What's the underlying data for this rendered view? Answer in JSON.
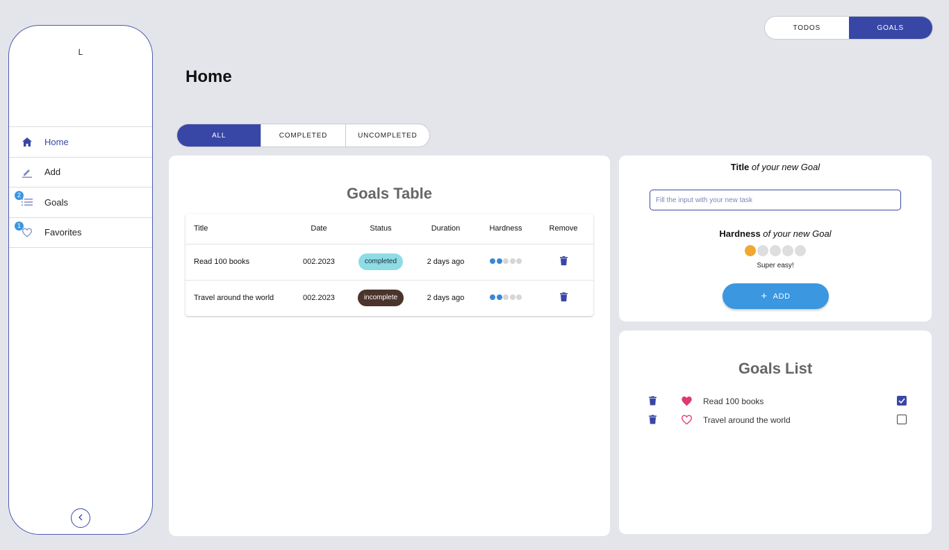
{
  "sidebar": {
    "avatar_initial": "L",
    "items": [
      {
        "label": "Home",
        "icon": "home-icon",
        "active": true,
        "badge": null
      },
      {
        "label": "Add",
        "icon": "edit-icon",
        "active": false,
        "badge": null
      },
      {
        "label": "Goals",
        "icon": "list-icon",
        "active": false,
        "badge": "2"
      },
      {
        "label": "Favorites",
        "icon": "heart-outline-icon",
        "active": false,
        "badge": "1"
      }
    ],
    "collapse_icon": "chevron-left-icon"
  },
  "top_toggle": {
    "todos_label": "TODOS",
    "goals_label": "GOALS",
    "active": "GOALS"
  },
  "page": {
    "title": "Home"
  },
  "filter": {
    "all_label": "ALL",
    "completed_label": "COMPLETED",
    "uncompleted_label": "UNCOMPLETED",
    "active": "ALL"
  },
  "goals_table": {
    "heading": "Goals Table",
    "columns": [
      "Title",
      "Date",
      "Status",
      "Duration",
      "Hardness",
      "Remove"
    ],
    "rows": [
      {
        "title": "Read 100 books",
        "date": "002.2023",
        "status": "completed",
        "duration": "2 days ago",
        "hardness": 2
      },
      {
        "title": "Travel around the world",
        "date": "002.2023",
        "status": "incomplete",
        "duration": "2 days ago",
        "hardness": 2
      }
    ],
    "hardness_max": 5
  },
  "new_goal_form": {
    "title_bold": "Title",
    "title_italic": "of your new Goal",
    "input_placeholder": "Fill the input with your new task",
    "input_value": "",
    "hardness_bold": "Hardness",
    "hardness_italic": "of your new Goal",
    "hardness_level": 1,
    "hardness_max": 5,
    "hardness_label": "Super easy!",
    "add_button_label": "ADD"
  },
  "goals_list": {
    "heading": "Goals List",
    "items": [
      {
        "title": "Read 100 books",
        "favorite": true,
        "checked": true
      },
      {
        "title": "Travel around the world",
        "favorite": false,
        "checked": false
      }
    ]
  },
  "colors": {
    "primary": "#3847a6",
    "accent_blue": "#3a97e0",
    "completed_chip": "#8fdbe6",
    "incomplete_chip": "#4a342b",
    "hardness_on": "#f0a830",
    "heart": "#e03a6a",
    "background": "#e3e5ea"
  }
}
